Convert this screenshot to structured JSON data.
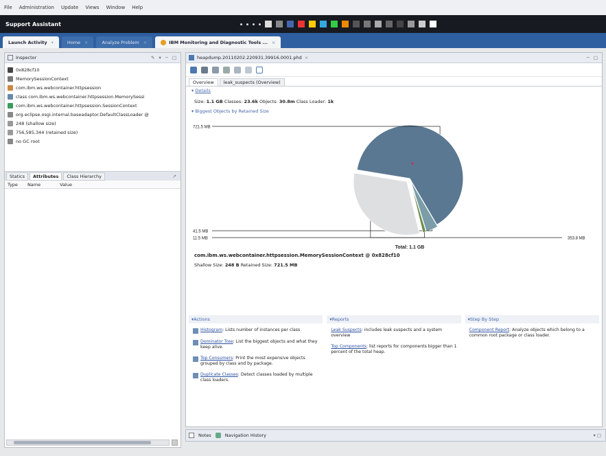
{
  "menubar": [
    "File",
    "Administration",
    "Update",
    "Views",
    "Window",
    "Help"
  ],
  "titlebar": {
    "title": "Support Assistant"
  },
  "perspective_tabs": [
    {
      "label": "Launch Activity",
      "active": true
    },
    {
      "label": "Home",
      "active": false
    },
    {
      "label": "Analyze Problem",
      "active": false
    },
    {
      "label": "IBM Monitoring and Diagnostic Tools ...",
      "active": true
    }
  ],
  "inspector": {
    "title": "Inspector",
    "items": [
      {
        "text": "0x828cf10",
        "icon": "object-icon",
        "color": "#444"
      },
      {
        "text": "MemorySessionContext",
        "icon": "class-icon",
        "color": "#777"
      },
      {
        "text": "com.ibm.ws.webcontainer.httpsession",
        "icon": "package-icon",
        "color": "#cc8844"
      },
      {
        "text": "class com.ibm.ws.webcontainer.httpsession.MemorySessi",
        "icon": "class-file-icon",
        "color": "#6688aa"
      },
      {
        "text": "com.ibm.ws.webcontainer.httpsession.SessionContext",
        "icon": "superclass-icon",
        "color": "#3a9b5a"
      },
      {
        "text": "org.eclipse.osgi.internal.baseadaptor.DefaultClassLoader @",
        "icon": "classloader-icon",
        "color": "#888"
      },
      {
        "text": "248 (shallow size)",
        "icon": "size-icon",
        "color": "#999"
      },
      {
        "text": "756,585,344 (retained size)",
        "icon": "size-icon",
        "color": "#999"
      },
      {
        "text": "no GC root",
        "icon": "gc-root-icon",
        "color": "#888"
      }
    ],
    "subtabs": [
      "Statics",
      "Attributes",
      "Class Hierarchy"
    ],
    "columns": [
      "Type",
      "Name",
      "Value"
    ]
  },
  "editor": {
    "title": "heapdump.20110202.220931.39916.0001.phd",
    "tabs": [
      "Overview",
      "leak_suspects (Overview)"
    ],
    "details_title": "Details",
    "details": {
      "size_label": "Size:",
      "size": "1.1 GB",
      "classes_label": "Classes:",
      "classes": "23.6k",
      "objects_label": "Objects:",
      "objects": "30.8m",
      "loaders_label": "Class Loader:",
      "loaders": "1k"
    },
    "biggest_title": "Biggest Objects by Retained Size",
    "biggest_object": "com.ibm.ws.webcontainer.httpsession.MemorySessionContext @ 0x828cf10",
    "shallow_line": {
      "shallow_label": "Shallow Size:",
      "shallow": "248 B",
      "retained_label": "Retained Size:",
      "retained": "721.5 MB"
    },
    "actions": {
      "title": "Actions",
      "items": [
        {
          "link": "Histogram",
          "text": ": Lists number of instances per class",
          "icon": "histogram-icon"
        },
        {
          "link": "Dominator Tree",
          "text": ": List the biggest objects and what they keep alive.",
          "icon": "dominator-tree-icon"
        },
        {
          "link": "Top Consumers",
          "text": ": Print the most expensive objects grouped by class and by package.",
          "icon": "top-consumers-icon"
        },
        {
          "link": "Duplicate Classes",
          "text": ": Detect classes loaded by multiple class loaders.",
          "icon": "duplicate-classes-icon"
        }
      ]
    },
    "reports": {
      "title": "Reports",
      "items": [
        {
          "link": "Leak Suspects",
          "text": ": includes leak suspects and a system overview"
        },
        {
          "link": "Top Components",
          "text": ": list reports for components bigger than 1 percent of the total heap."
        }
      ]
    },
    "step_by_step": {
      "title": "Step By Step",
      "items": [
        {
          "link": "Component Report",
          "text": ": Analyze objects which belong to a common root package or class loader."
        }
      ]
    }
  },
  "notes": {
    "tabs": [
      "Notes",
      "Navigation History"
    ]
  },
  "chart_data": {
    "type": "pie",
    "title": "",
    "total_label": "Total: 1.1 GB",
    "slices": [
      {
        "label": "721.5 MB",
        "value": 721.5,
        "color": "#5b7892"
      },
      {
        "label": "41.5 MB",
        "value": 41.5,
        "color": "#7a9da8"
      },
      {
        "label": "11.5 MB",
        "value": 11.5,
        "color": "#6f8c50"
      },
      {
        "label": "353.8 MB",
        "value": 353.8,
        "color": "#dedfe0"
      }
    ]
  }
}
